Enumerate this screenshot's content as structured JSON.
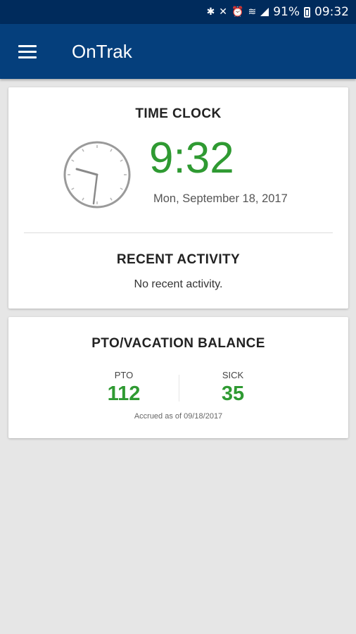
{
  "status_bar": {
    "icons": [
      "bluetooth-icon",
      "mute-icon",
      "alarm-icon",
      "wifi-icon",
      "signal-icon",
      "battery-icon"
    ],
    "battery": "91%",
    "time": "09:32"
  },
  "app_bar": {
    "title": "OnTrak",
    "menu_icon": "hamburger-menu-icon"
  },
  "time_clock": {
    "title": "TIME CLOCK",
    "time": "9:32",
    "date": "Mon, September 18, 2017",
    "clock_icon": "analog-clock-icon"
  },
  "recent_activity": {
    "title": "RECENT ACTIVITY",
    "empty_text": "No recent activity."
  },
  "pto": {
    "title": "PTO/VACATION BALANCE",
    "balances": [
      {
        "label": "PTO",
        "value": "112"
      },
      {
        "label": "SICK",
        "value": "35"
      }
    ],
    "accrued": "Accrued as of 09/18/2017"
  },
  "colors": {
    "status_bar": "#002b5c",
    "app_bar": "#053f7c",
    "accent_green": "#2f9a32",
    "background": "#e6e6e6"
  }
}
